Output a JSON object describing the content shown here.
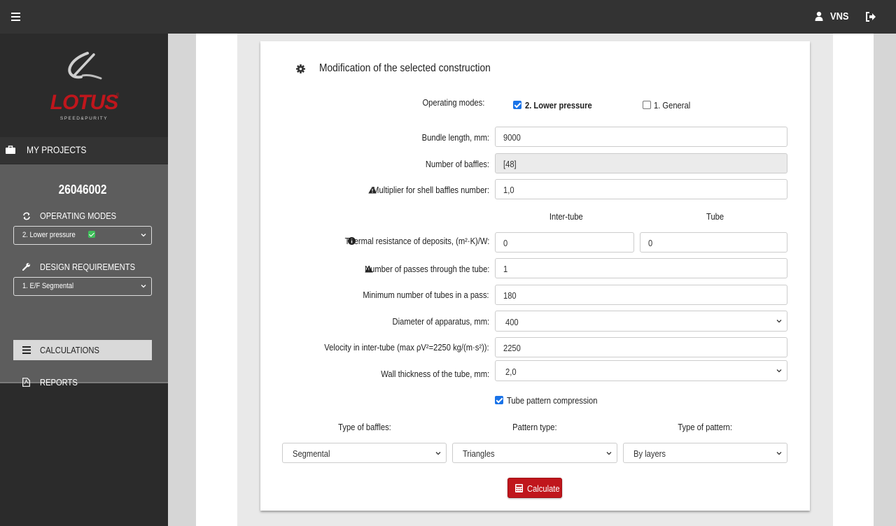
{
  "topbar": {
    "user_name": "VNS",
    "icons": [
      "hamburger-icon",
      "user-icon",
      "logout-icon"
    ]
  },
  "sidebar": {
    "logo_text": "LOTUS",
    "logo_tagline": "SPEED&PURITY",
    "my_projects": "MY PROJECTS",
    "project_id": "26046002",
    "operating_modes_title": "OPERATING MODES",
    "operating_modes_value": "2. Lower pressure",
    "design_requirements_title": "DESIGN REQUIREMENTS",
    "design_requirements_value": "1. E/F Segmental",
    "calculations": "CALCULATIONS",
    "reports": "REPORTS"
  },
  "form": {
    "title": "Modification of the selected construction",
    "operating_modes_label": "Operating modes:",
    "mode_options": [
      {
        "label": "2. Lower pressure",
        "checked": true
      },
      {
        "label": "1. General",
        "checked": false
      }
    ],
    "bundle_length_label": "Bundle length, mm:",
    "bundle_length_value": "9000",
    "baffles_label": "Number of baffles:",
    "baffles_value": "[48]",
    "multiplier_label": "Multiplier for shell baffles number:",
    "multiplier_value": "1,0",
    "col_inter_tube": "Inter-tube",
    "col_tube": "Tube",
    "thermal_label": "Thermal resistance of deposits, (m²·K)/W:",
    "thermal_inter_value": "0",
    "thermal_tube_value": "0",
    "passes_label": "Number of passes through the tube:",
    "passes_value": "1",
    "min_tubes_label": "Minimum number of tubes in a pass:",
    "min_tubes_value": "180",
    "diameter_label": "Diameter of apparatus, mm:",
    "diameter_value": "400",
    "velocity_label": "Velocity in inter-tube (max ρV²=2250 kg/(m·s²)):",
    "velocity_value": "2250",
    "wall_label": "Wall thickness of the tube, mm:",
    "wall_value": "2,0",
    "compression_label": "Tube pattern compression",
    "compression_checked": true,
    "type_baffles_label": "Type of baffles:",
    "type_baffles_value": "Segmental",
    "pattern_type_label": "Pattern type:",
    "pattern_type_value": "Triangles",
    "type_pattern_label": "Type of pattern:",
    "type_pattern_value": "By layers",
    "calculate_button": "Calculate"
  },
  "colors": {
    "topbar": "#333333",
    "sidebar": "#2b2b2b",
    "panel": "#5d5d5d",
    "accent_red": "#c0161c",
    "checkbox_blue": "#1a73e8"
  }
}
